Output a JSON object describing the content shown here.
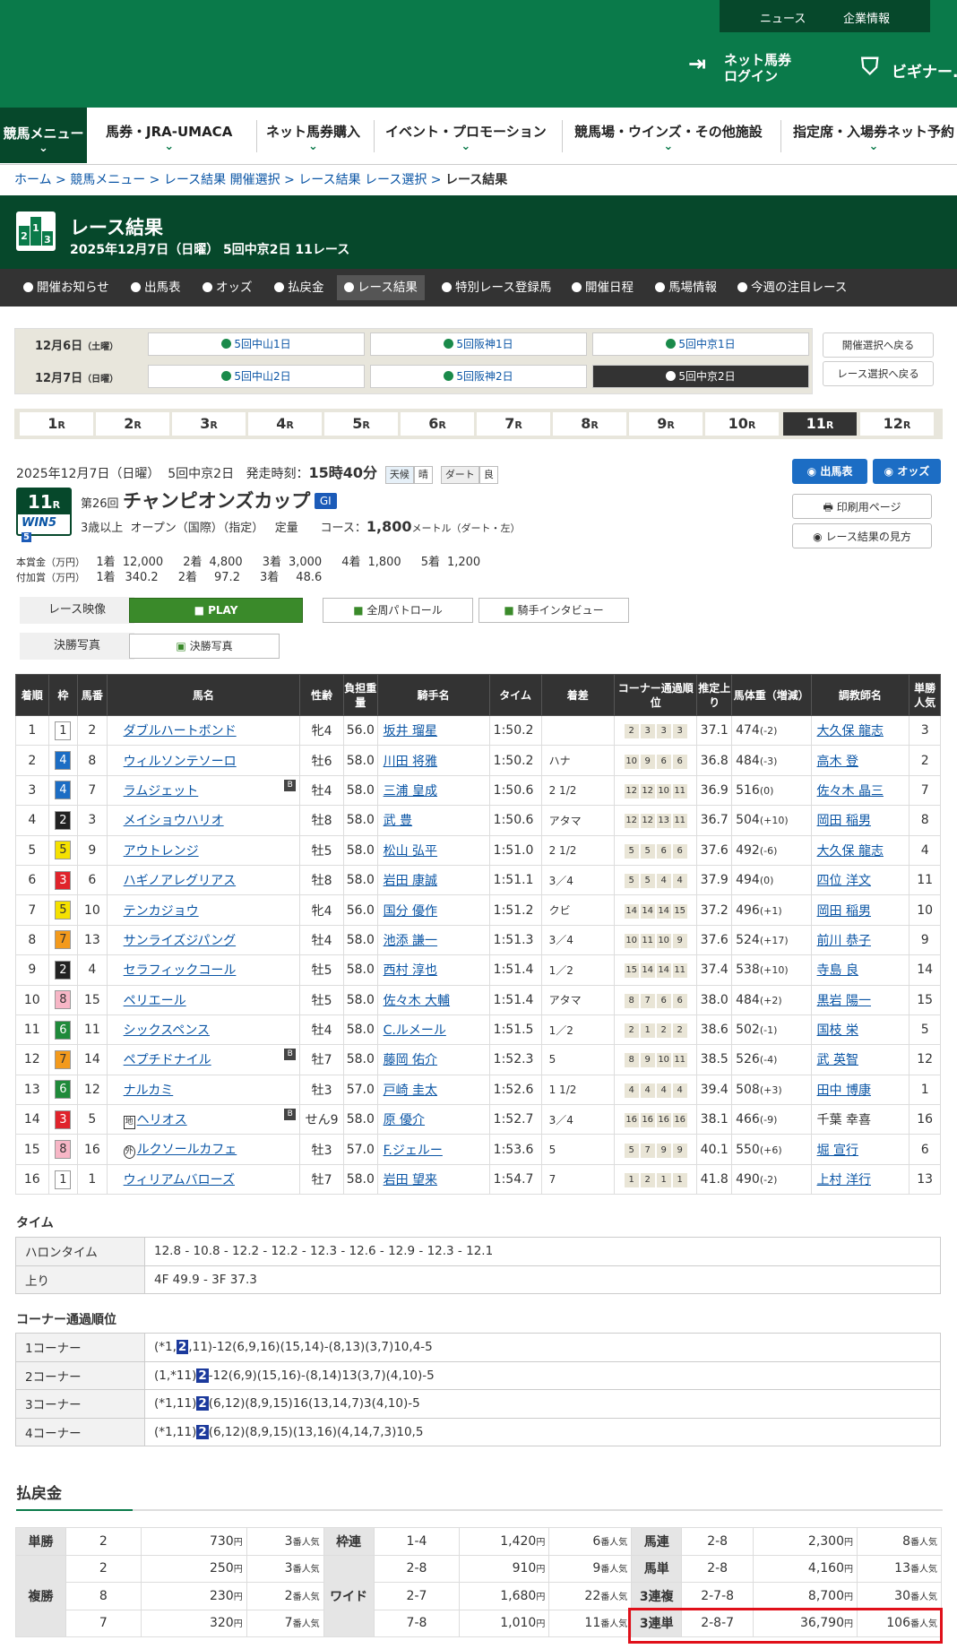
{
  "header": {
    "news": "ニュース",
    "corp": "企業情報",
    "login_line1": "ネット馬券",
    "login_line2": "ログイン",
    "beginner": "ビギナー..."
  },
  "gnav": [
    "競馬メニュー",
    "馬券・JRA-UMACA",
    "ネット馬券購入",
    "イベント・プロモーション",
    "競馬場・ウインズ・その他施設",
    "指定席・入場券ネット予約"
  ],
  "breadcrumb": [
    "ホーム",
    "競馬メニュー",
    "レース結果 開催選択",
    "レース結果 レース選択",
    "レース結果"
  ],
  "page": {
    "title": "レース結果",
    "subtitle": "2025年12月7日（日曜） 5回中京2日 11レース"
  },
  "subnav": [
    "開催お知らせ",
    "出馬表",
    "オッズ",
    "払戻金",
    "レース結果",
    "特別レース登録馬",
    "開催日程",
    "馬場情報",
    "今週の注目レース"
  ],
  "days": [
    {
      "label": "12月6日",
      "dow": "（土曜）",
      "venues": [
        "5回中山1日",
        "5回阪神1日",
        "5回中京1日"
      ]
    },
    {
      "label": "12月7日",
      "dow": "（日曜）",
      "venues": [
        "5回中山2日",
        "5回阪神2日",
        "5回中京2日"
      ]
    }
  ],
  "back_buttons": [
    "開催選択へ戻る",
    "レース選択へ戻る"
  ],
  "race_tabs": [
    "1",
    "2",
    "3",
    "4",
    "5",
    "6",
    "7",
    "8",
    "9",
    "10",
    "11",
    "12"
  ],
  "race_tab_suffix": "R",
  "race": {
    "date": "2025年12月7日（日曜）",
    "meet": "5回中京2日",
    "start_label": "発走時刻：",
    "start_time": "15時40分",
    "weather_label": "天候",
    "weather": "晴",
    "track_label": "ダート",
    "track_cond": "良",
    "num": "11",
    "num_r": "R",
    "win5": "WIN5",
    "win5n": "5",
    "kai": "第26回",
    "name": "チャンピオンズカップ",
    "grade": "GI",
    "cond": "3歳以上",
    "class": "オープン（国際）（指定）",
    "weight": "定量",
    "course_label": "コース：",
    "distance": "1,800",
    "course_unit": "メートル（ダート・左）"
  },
  "action_buttons": {
    "entries": "出馬表",
    "odds": "オッズ",
    "print": "印刷用ページ",
    "howto": "レース結果の見方"
  },
  "prizes": {
    "main_label": "本賞金（万円）",
    "sub_label": "付加賞（万円）",
    "main": [
      [
        "1着",
        "12,000"
      ],
      [
        "2着",
        "4,800"
      ],
      [
        "3着",
        "3,000"
      ],
      [
        "4着",
        "1,800"
      ],
      [
        "5着",
        "1,200"
      ]
    ],
    "sub": [
      [
        "1着",
        "340.2"
      ],
      [
        "2着",
        "97.2"
      ],
      [
        "3着",
        "48.6"
      ]
    ]
  },
  "video": {
    "label": "レース映像",
    "play": "PLAY",
    "patrol": "全周パトロール",
    "interview": "騎手インタビュー",
    "photo_label": "決勝写真",
    "photo": "決勝写真"
  },
  "results_headers": [
    "着順",
    "枠",
    "馬番",
    "馬名",
    "性齢",
    "負担重量",
    "騎手名",
    "タイム",
    "着差",
    "コーナー通過順位",
    "推定上り",
    "馬体重（増減）",
    "調教師名",
    "単勝人気"
  ],
  "results": [
    {
      "pos": "1",
      "waku": "1",
      "num": "2",
      "horse": "ダブルハートボンド",
      "sex": "牝4",
      "wt": "56.0",
      "jockey": "坂井 瑠星",
      "time": "1:50.2",
      "margin": "",
      "corners": [
        "2",
        "3",
        "3",
        "3"
      ],
      "last3f": "37.1",
      "bw": "474",
      "bwd": "(-2)",
      "trainer": "大久保 龍志",
      "pop": "3",
      "b": false,
      "mark": ""
    },
    {
      "pos": "2",
      "waku": "4",
      "num": "8",
      "horse": "ウィルソンテソーロ",
      "sex": "牡6",
      "wt": "58.0",
      "jockey": "川田 将雅",
      "time": "1:50.2",
      "margin": "ハナ",
      "corners": [
        "10",
        "9",
        "6",
        "6"
      ],
      "last3f": "36.8",
      "bw": "484",
      "bwd": "(-3)",
      "trainer": "高木 登",
      "pop": "2",
      "b": false,
      "mark": ""
    },
    {
      "pos": "3",
      "waku": "4",
      "num": "7",
      "horse": "ラムジェット",
      "sex": "牡4",
      "wt": "58.0",
      "jockey": "三浦 皇成",
      "time": "1:50.6",
      "margin": "2 1/2",
      "corners": [
        "12",
        "12",
        "10",
        "11"
      ],
      "last3f": "36.9",
      "bw": "516",
      "bwd": "(0)",
      "trainer": "佐々木 晶三",
      "pop": "7",
      "b": true,
      "mark": ""
    },
    {
      "pos": "4",
      "waku": "2",
      "num": "3",
      "horse": "メイショウハリオ",
      "sex": "牡8",
      "wt": "58.0",
      "jockey": "武 豊",
      "time": "1:50.6",
      "margin": "アタマ",
      "corners": [
        "12",
        "12",
        "13",
        "11"
      ],
      "last3f": "36.7",
      "bw": "504",
      "bwd": "(+10)",
      "trainer": "岡田 稲男",
      "pop": "8",
      "b": false,
      "mark": ""
    },
    {
      "pos": "5",
      "waku": "5",
      "num": "9",
      "horse": "アウトレンジ",
      "sex": "牡5",
      "wt": "58.0",
      "jockey": "松山 弘平",
      "time": "1:51.0",
      "margin": "2 1/2",
      "corners": [
        "5",
        "5",
        "6",
        "6"
      ],
      "last3f": "37.6",
      "bw": "492",
      "bwd": "(-6)",
      "trainer": "大久保 龍志",
      "pop": "4",
      "b": false,
      "mark": ""
    },
    {
      "pos": "6",
      "waku": "3",
      "num": "6",
      "horse": "ハギノアレグリアス",
      "sex": "牡8",
      "wt": "58.0",
      "jockey": "岩田 康誠",
      "time": "1:51.1",
      "margin": "3／4",
      "corners": [
        "5",
        "5",
        "4",
        "4"
      ],
      "last3f": "37.9",
      "bw": "494",
      "bwd": "(0)",
      "trainer": "四位 洋文",
      "pop": "11",
      "b": false,
      "mark": ""
    },
    {
      "pos": "7",
      "waku": "5",
      "num": "10",
      "horse": "テンカジョウ",
      "sex": "牝4",
      "wt": "56.0",
      "jockey": "国分 優作",
      "time": "1:51.2",
      "margin": "クビ",
      "corners": [
        "14",
        "14",
        "14",
        "15"
      ],
      "last3f": "37.2",
      "bw": "496",
      "bwd": "(+1)",
      "trainer": "岡田 稲男",
      "pop": "10",
      "b": false,
      "mark": ""
    },
    {
      "pos": "8",
      "waku": "7",
      "num": "13",
      "horse": "サンライズジパング",
      "sex": "牡4",
      "wt": "58.0",
      "jockey": "池添 謙一",
      "time": "1:51.3",
      "margin": "3／4",
      "corners": [
        "10",
        "11",
        "10",
        "9"
      ],
      "last3f": "37.6",
      "bw": "524",
      "bwd": "(+17)",
      "trainer": "前川 恭子",
      "pop": "9",
      "b": false,
      "mark": ""
    },
    {
      "pos": "9",
      "waku": "2",
      "num": "4",
      "horse": "セラフィックコール",
      "sex": "牡5",
      "wt": "58.0",
      "jockey": "西村 淳也",
      "time": "1:51.4",
      "margin": "1／2",
      "corners": [
        "15",
        "14",
        "14",
        "11"
      ],
      "last3f": "37.4",
      "bw": "538",
      "bwd": "(+10)",
      "trainer": "寺島 良",
      "pop": "14",
      "b": false,
      "mark": ""
    },
    {
      "pos": "10",
      "waku": "8",
      "num": "15",
      "horse": "ペリエール",
      "sex": "牡5",
      "wt": "58.0",
      "jockey": "佐々木 大輔",
      "time": "1:51.4",
      "margin": "アタマ",
      "corners": [
        "8",
        "7",
        "6",
        "6"
      ],
      "last3f": "38.0",
      "bw": "484",
      "bwd": "(+2)",
      "trainer": "黒岩 陽一",
      "pop": "15",
      "b": false,
      "mark": ""
    },
    {
      "pos": "11",
      "waku": "6",
      "num": "11",
      "horse": "シックスペンス",
      "sex": "牡4",
      "wt": "58.0",
      "jockey": "C.ルメール",
      "time": "1:51.5",
      "margin": "1／2",
      "corners": [
        "2",
        "1",
        "2",
        "2"
      ],
      "last3f": "38.6",
      "bw": "502",
      "bwd": "(-1)",
      "trainer": "国枝 栄",
      "pop": "5",
      "b": false,
      "mark": ""
    },
    {
      "pos": "12",
      "waku": "7",
      "num": "14",
      "horse": "ペプチドナイル",
      "sex": "牡7",
      "wt": "58.0",
      "jockey": "藤岡 佑介",
      "time": "1:52.3",
      "margin": "5",
      "corners": [
        "8",
        "9",
        "10",
        "11"
      ],
      "last3f": "38.5",
      "bw": "526",
      "bwd": "(-4)",
      "trainer": "武 英智",
      "pop": "12",
      "b": true,
      "mark": ""
    },
    {
      "pos": "13",
      "waku": "6",
      "num": "12",
      "horse": "ナルカミ",
      "sex": "牡3",
      "wt": "57.0",
      "jockey": "戸崎 圭太",
      "time": "1:52.6",
      "margin": "1 1/2",
      "corners": [
        "4",
        "4",
        "4",
        "4"
      ],
      "last3f": "39.4",
      "bw": "508",
      "bwd": "(+3)",
      "trainer": "田中 博康",
      "pop": "1",
      "b": false,
      "mark": ""
    },
    {
      "pos": "14",
      "waku": "3",
      "num": "5",
      "horse": "ヘリオス",
      "sex": "せん9",
      "wt": "58.0",
      "jockey": "原 優介",
      "time": "1:52.7",
      "margin": "3／4",
      "corners": [
        "16",
        "16",
        "16",
        "16"
      ],
      "last3f": "38.1",
      "bw": "466",
      "bwd": "(-9)",
      "trainer": "千葉 幸喜",
      "pop": "16",
      "b": true,
      "mark": "地"
    },
    {
      "pos": "15",
      "waku": "8",
      "num": "16",
      "horse": "ルクソールカフェ",
      "sex": "牡3",
      "wt": "57.0",
      "jockey": "F.ジェルー",
      "time": "1:53.6",
      "margin": "5",
      "corners": [
        "5",
        "7",
        "9",
        "9"
      ],
      "last3f": "40.1",
      "bw": "550",
      "bwd": "(+6)",
      "trainer": "堀 宣行",
      "pop": "6",
      "b": false,
      "mark": "外"
    },
    {
      "pos": "16",
      "waku": "1",
      "num": "1",
      "horse": "ウィリアムバローズ",
      "sex": "牡7",
      "wt": "58.0",
      "jockey": "岩田 望来",
      "time": "1:54.7",
      "margin": "7",
      "corners": [
        "1",
        "2",
        "1",
        "1"
      ],
      "last3f": "41.8",
      "bw": "490",
      "bwd": "(-2)",
      "trainer": "上村 洋行",
      "pop": "13",
      "b": false,
      "mark": ""
    }
  ],
  "waku_colors": {
    "1": [
      "#ffffff",
      "#333333"
    ],
    "2": [
      "#222222",
      "#ffffff"
    ],
    "3": [
      "#e0232b",
      "#ffffff"
    ],
    "4": [
      "#1c6dc4",
      "#ffffff"
    ],
    "5": [
      "#f5e100",
      "#333333"
    ],
    "6": [
      "#1f8a3a",
      "#ffffff"
    ],
    "7": [
      "#f39a1c",
      "#333333"
    ],
    "8": [
      "#f7b6c6",
      "#333333"
    ]
  },
  "time_section": {
    "title": "タイム",
    "rows": [
      [
        "ハロンタイム",
        "12.8 - 10.8 - 12.2 - 12.2 - 12.3 - 12.6 - 12.9 - 12.3 - 12.1"
      ],
      [
        "上り",
        "4F 49.9 - 3F 37.3"
      ]
    ]
  },
  "corner_section": {
    "title": "コーナー通過順位",
    "rows": [
      {
        "label": "1コーナー",
        "pre": "(*1,",
        "hl": "2",
        "post": ",11)-12(6,9,16)(15,14)-(8,13)(3,7)10,4-5"
      },
      {
        "label": "2コーナー",
        "pre": "(1,*11)",
        "hl": "2",
        "post": "-12(6,9)(15,16)-(8,14)13(3,7)(4,10)-5"
      },
      {
        "label": "3コーナー",
        "pre": "(*1,11)",
        "hl": "2",
        "post": "(6,12)(8,9,15)16(13,14,7)3(4,10)-5"
      },
      {
        "label": "4コーナー",
        "pre": "(*1,11)",
        "hl": "2",
        "post": "(6,12)(8,9,15)(13,16)(4,14,7,3)10,5"
      }
    ]
  },
  "payout": {
    "title": "払戻金",
    "yen": "円",
    "ninki": "番人気",
    "tansho": {
      "label": "単勝",
      "num": "2",
      "yen": "730",
      "pop": "3"
    },
    "fukusho": {
      "label": "複勝",
      "rows": [
        {
          "num": "2",
          "yen": "250",
          "pop": "3"
        },
        {
          "num": "8",
          "yen": "230",
          "pop": "2"
        },
        {
          "num": "7",
          "yen": "320",
          "pop": "7"
        }
      ]
    },
    "wakuren": {
      "label": "枠連",
      "num": "1-4",
      "yen": "1,420",
      "pop": "6"
    },
    "wide": {
      "label": "ワイド",
      "rows": [
        {
          "num": "2-8",
          "yen": "910",
          "pop": "9"
        },
        {
          "num": "2-7",
          "yen": "1,680",
          "pop": "22"
        },
        {
          "num": "7-8",
          "yen": "1,010",
          "pop": "11"
        }
      ]
    },
    "umaren": {
      "label": "馬連",
      "num": "2-8",
      "yen": "2,300",
      "pop": "8"
    },
    "umatan": {
      "label": "馬単",
      "num": "2-8",
      "yen": "4,160",
      "pop": "13"
    },
    "sanrenpuku": {
      "label": "3連複",
      "num": "2-7-8",
      "yen": "8,700",
      "pop": "30"
    },
    "sanrentan": {
      "label": "3連単",
      "num": "2-8-7",
      "yen": "36,790",
      "pop": "106"
    }
  }
}
